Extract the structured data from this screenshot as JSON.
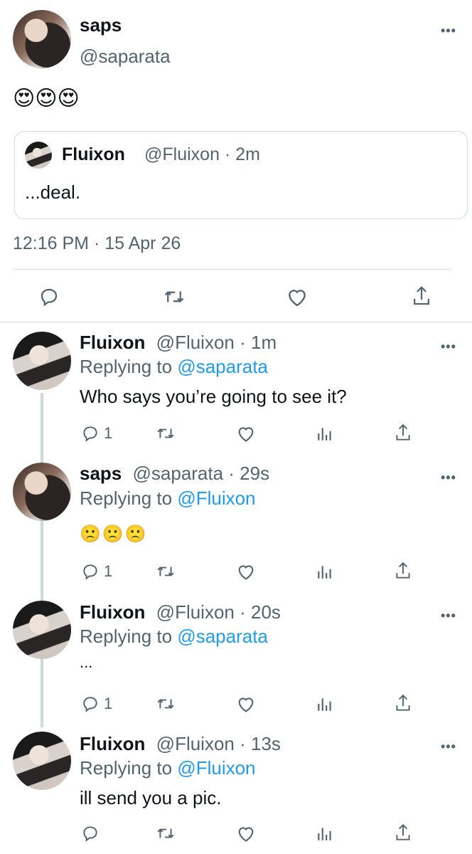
{
  "main_tweet": {
    "name": "saps",
    "handle": "@saparata",
    "emoji": "😍😍😍",
    "quote": {
      "name": "Fluixon",
      "meta": "@Fluixon · 2m",
      "text": "...deal."
    },
    "timestamp": "12:16 PM · 15 Apr 26"
  },
  "replies": [
    {
      "name": "Fluixon",
      "meta": "@Fluixon · 1m",
      "replying_prefix": "Replying to ",
      "replying_to": "@saparata",
      "text": "Who says you’re going to see it?",
      "reply_count": "1"
    },
    {
      "name": "saps",
      "meta": "@saparata · 29s",
      "replying_prefix": "Replying to ",
      "replying_to": "@Fluixon",
      "text": "🙁🙁🙁",
      "reply_count": "1"
    },
    {
      "name": "Fluixon",
      "meta": "@Fluixon · 20s",
      "replying_prefix": "Replying to ",
      "replying_to": "@saparata",
      "text": "...",
      "reply_count": "1"
    },
    {
      "name": "Fluixon",
      "meta": "@Fluixon · 13s",
      "replying_prefix": "Replying to ",
      "replying_to": "@Fluixon",
      "text": "ill send you a pic.",
      "reply_count": ""
    }
  ],
  "icons": [
    "more-icon",
    "reply-icon",
    "retweet-icon",
    "like-icon",
    "share-icon",
    "analytics-icon"
  ],
  "colors": {
    "link": "#1d9bf0",
    "secondary": "#536471",
    "divider": "#cfd9de"
  }
}
